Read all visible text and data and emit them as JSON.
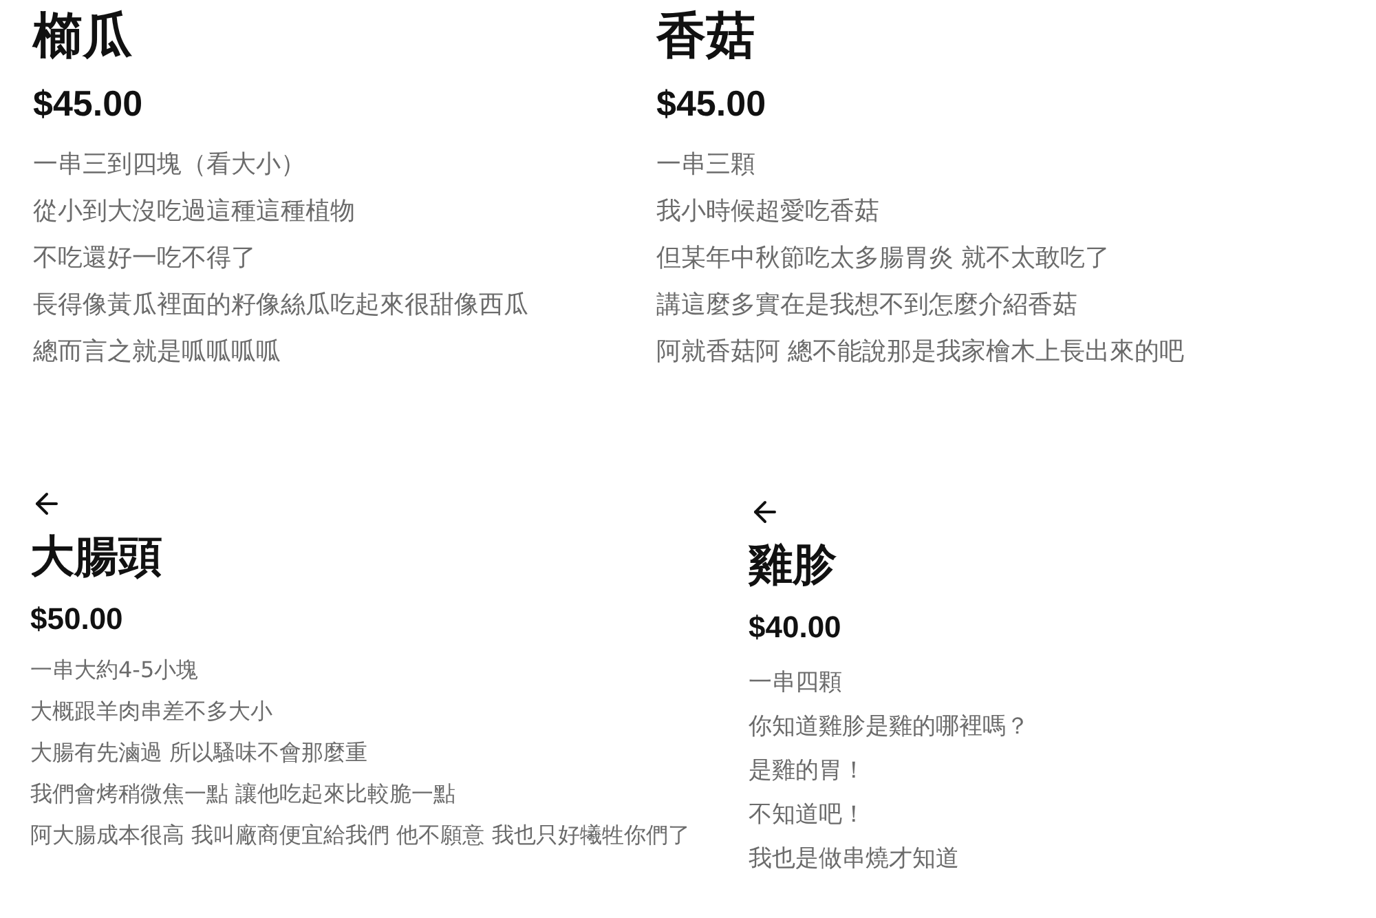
{
  "panels": [
    {
      "title": "櫛瓜",
      "price": "$45.00",
      "lines": [
        "一串三到四塊（看大小）",
        "從小到大沒吃過這種這種植物",
        "不吃還好一吃不得了",
        "長得像黃瓜裡面的籽像絲瓜吃起來很甜像西瓜",
        "總而言之就是呱呱呱呱"
      ]
    },
    {
      "title": "香菇",
      "price": "$45.00",
      "lines": [
        "一串三顆",
        "我小時候超愛吃香菇",
        "但某年中秋節吃太多腸胃炎 就不太敢吃了",
        "講這麼多實在是我想不到怎麼介紹香菇",
        "阿就香菇阿 總不能說那是我家檜木上長出來的吧"
      ]
    },
    {
      "back": true,
      "title": "大腸頭",
      "price": "$50.00",
      "lines": [
        "一串大約4-5小塊",
        "大概跟羊肉串差不多大小",
        "大腸有先滷過 所以騷味不會那麼重",
        "我們會烤稍微焦一點 讓他吃起來比較脆一點",
        "阿大腸成本很高 我叫廠商便宜給我們 他不願意 我也只好犧牲你們了"
      ]
    },
    {
      "back": true,
      "title": "雞胗",
      "price": "$40.00",
      "lines": [
        "一串四顆",
        "你知道雞胗是雞的哪裡嗎？",
        "是雞的胃！",
        "不知道吧！",
        "我也是做串燒才知道"
      ]
    }
  ]
}
